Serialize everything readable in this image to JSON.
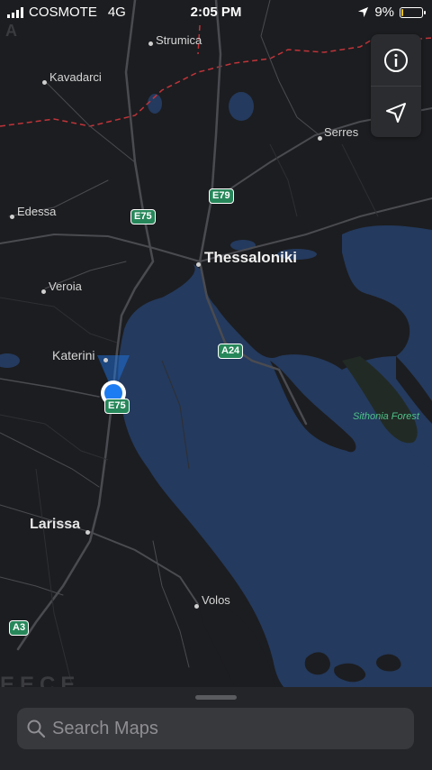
{
  "status_bar": {
    "carrier": "COSMOTE",
    "network": "4G",
    "time": "2:05 PM",
    "battery_percent": "9%",
    "battery_level": 0.09
  },
  "map": {
    "cities": {
      "strumica": "Strumica",
      "kavadarci": "Kavadarci",
      "serres": "Serres",
      "edessa": "Edessa",
      "thessaloniki": "Thessaloniki",
      "veroia": "Veroia",
      "katerini": "Katerini",
      "larissa": "Larissa",
      "volos": "Volos"
    },
    "roads": {
      "e79": "E79",
      "e75_north": "E75",
      "a24": "A24",
      "e75_south": "E75",
      "a3": "A3"
    },
    "features": {
      "sithonia_forest": "Sithonia Forest",
      "country_fragment_top": "A",
      "country_fragment_bottom": "EECE"
    },
    "colors": {
      "land": "#1c1d20",
      "water": "#243a5e",
      "road": "#4a4b50",
      "border": "#c0343a",
      "shield": "#27875a",
      "location": "#1e7cf2"
    }
  },
  "controls": {
    "info_icon": "info-icon",
    "location_icon": "location-arrow-icon"
  },
  "search": {
    "placeholder": "Search Maps"
  }
}
